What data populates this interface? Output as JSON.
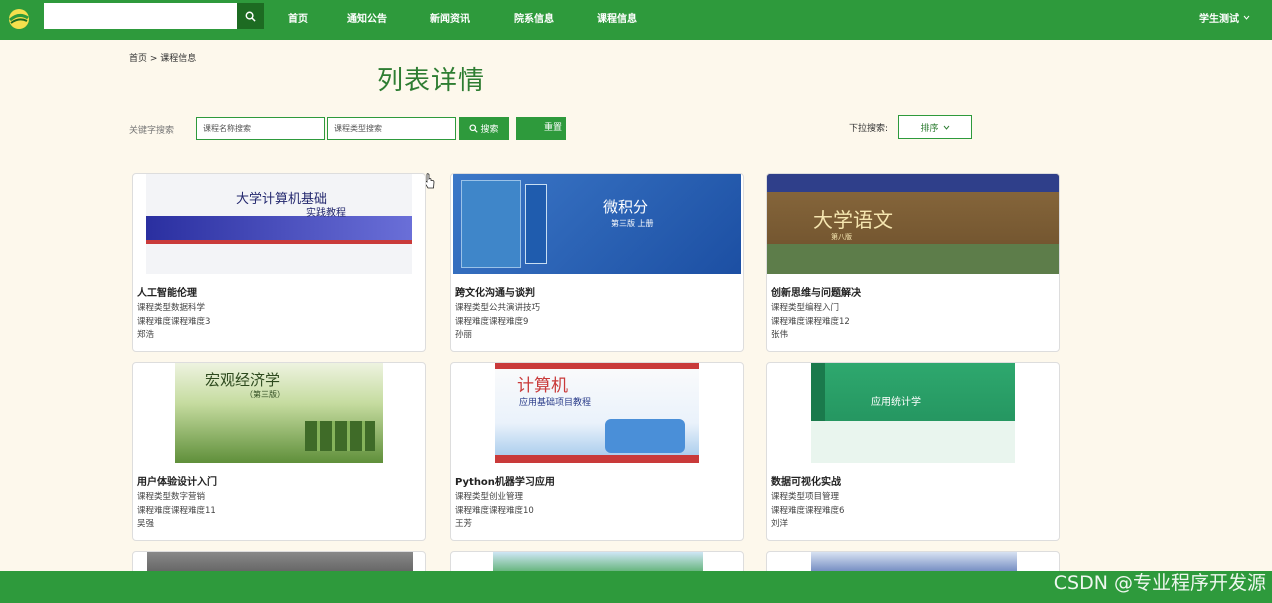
{
  "nav": {
    "items": [
      "首页",
      "通知公告",
      "新闻资讯",
      "院系信息",
      "课程信息"
    ],
    "user": "学生测试"
  },
  "breadcrumb": "首页 > 课程信息",
  "page_title": "列表详情",
  "filters": {
    "keyword_label": "关键字搜索",
    "name_placeholder": "课程名称搜索",
    "type_placeholder": "课程类型搜索",
    "search_label": "搜索",
    "reset_label": "重置",
    "dropdown_label": "下拉搜索:",
    "sort_label": "排序"
  },
  "courses": [
    {
      "name": "人工智能伦理",
      "type": "课程类型数据科学",
      "difficulty": "课程难度课程难度3",
      "teacher": "郑浩",
      "cover_text": "大学计算机基础",
      "cover_sub": "实践教程"
    },
    {
      "name": "跨文化沟通与谈判",
      "type": "课程类型公共演讲技巧",
      "difficulty": "课程难度课程难度9",
      "teacher": "孙丽",
      "cover_text": "微积分",
      "cover_sub": "第三版 上册"
    },
    {
      "name": "创新思维与问题解决",
      "type": "课程类型编程入门",
      "difficulty": "课程难度课程难度12",
      "teacher": "张伟",
      "cover_text": "大学语文",
      "cover_sub": "第八版"
    },
    {
      "name": "用户体验设计入门",
      "type": "课程类型数字营销",
      "difficulty": "课程难度课程难度11",
      "teacher": "吴强",
      "cover_text": "宏观经济学",
      "cover_sub": "（第三版）"
    },
    {
      "name": "Python机器学习应用",
      "type": "课程类型创业管理",
      "difficulty": "课程难度课程难度10",
      "teacher": "王芳",
      "cover_text": "计算机",
      "cover_sub": "应用基础项目教程"
    },
    {
      "name": "数据可视化实战",
      "type": "课程类型项目管理",
      "difficulty": "课程难度课程难度6",
      "teacher": "刘洋",
      "cover_text": "应用统计学",
      "cover_sub": ""
    }
  ],
  "watermark": "CSDN @专业程序开发源",
  "colors": {
    "primary": "#2e9a3c",
    "dark": "#1d6b22",
    "title": "#2e7d32",
    "background": "#fdf8ec"
  }
}
